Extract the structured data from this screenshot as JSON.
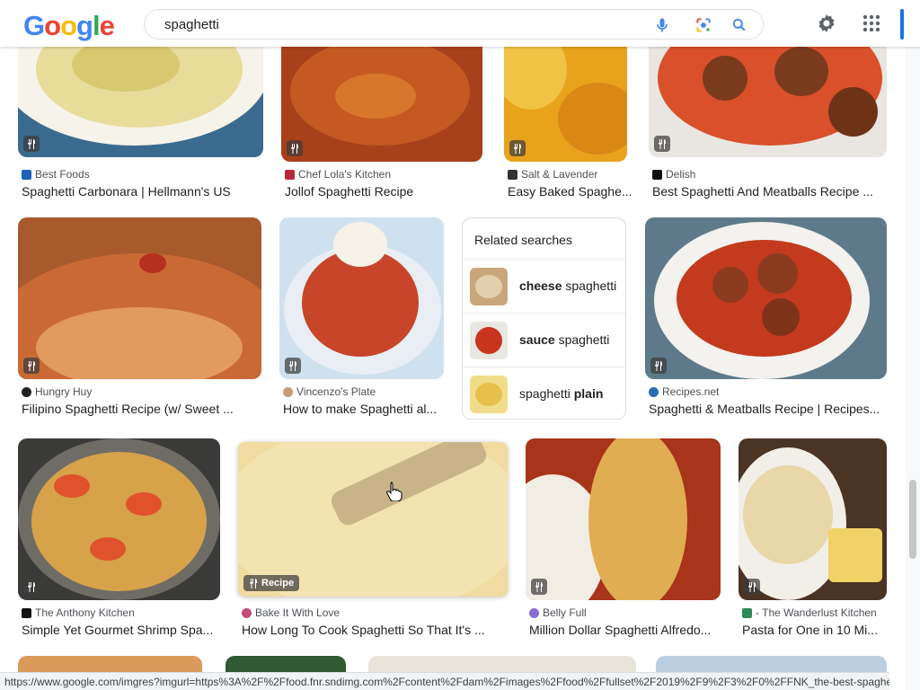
{
  "search": {
    "query": "spaghetti"
  },
  "logo": "Google",
  "row1": [
    {
      "source": "Best Foods",
      "title": "Spaghetti Carbonara | Hellmann's US"
    },
    {
      "source": "Chef Lola's Kitchen",
      "title": "Jollof Spaghetti Recipe"
    },
    {
      "source": "Salt & Lavender",
      "title": "Easy Baked Spaghe..."
    },
    {
      "source": "Delish",
      "title": "Best Spaghetti And Meatballs Recipe ..."
    }
  ],
  "row2": [
    {
      "source": "Hungry Huy",
      "title": "Filipino Spaghetti Recipe (w/ Sweet ..."
    },
    {
      "source": "Vincenzo's Plate",
      "title": "How to make Spaghetti al..."
    },
    {
      "source": "Recipes.net",
      "title": "Spaghetti & Meatballs Recipe | Recipes..."
    }
  ],
  "related": {
    "heading": "Related searches",
    "items": [
      {
        "bold": "cheese",
        "rest": " spaghetti"
      },
      {
        "bold": "sauce",
        "rest": " spaghetti"
      },
      {
        "pre": "spaghetti ",
        "bold": "plain"
      }
    ]
  },
  "row3": [
    {
      "source": "The Anthony Kitchen",
      "title": "Simple Yet Gourmet Shrimp Spa..."
    },
    {
      "source": "Bake It With Love",
      "title": "How Long To Cook Spaghetti So That It's ...",
      "badge": "Recipe"
    },
    {
      "source": "Belly Full",
      "title": "Million Dollar Spaghetti Alfredo..."
    },
    {
      "source": "- The Wanderlust Kitchen",
      "title": "Pasta for One in 10 Mi..."
    }
  ],
  "status_url": "https://www.google.com/imgres?imgurl=https%3A%2F%2Ffood.fnr.sndimg.com%2Fcontent%2Fdam%2Fimages%2Ffood%2Ffullset%2F2019%2F9%2F3%2F0%2FFNK_the-best-spaghetti...",
  "colors": {
    "blue": "#4285F4",
    "red": "#EA4335",
    "yellow": "#FBBC05",
    "green": "#34A853"
  }
}
